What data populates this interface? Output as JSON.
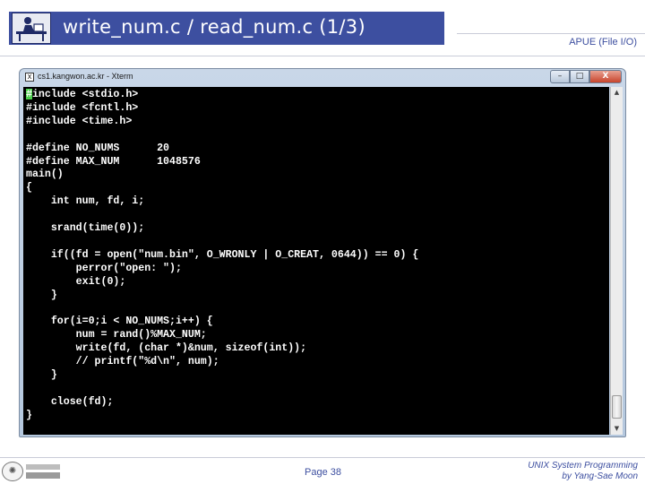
{
  "slide": {
    "title": "write_num.c / read_num.c (1/3)",
    "header_right": "APUE (File I/O)",
    "page": "Page 38",
    "course_line1": "UNIX System Programming",
    "course_line2": "by Yang-Sae Moon",
    "accent_color": "#3d4fa0"
  },
  "window": {
    "title": "cs1.kangwon.ac.kr - Xterm",
    "minimize_label": "–",
    "maximize_label": "□",
    "close_label": "X"
  },
  "code": [
    "#include <stdio.h>",
    "#include <fcntl.h>",
    "#include <time.h>",
    "",
    "#define NO_NUMS      20",
    "#define MAX_NUM      1048576",
    "main()",
    "{",
    "    int num, fd, i;",
    "",
    "    srand(time(0));",
    "",
    "    if((fd = open(\"num.bin\", O_WRONLY | O_CREAT, 0644)) == 0) {",
    "        perror(\"open: \");",
    "        exit(0);",
    "    }",
    "",
    "    for(i=0;i < NO_NUMS;i++) {",
    "        num = rand()%MAX_NUM;",
    "        write(fd, (char *)&num, sizeof(int));",
    "        // printf(\"%d\\n\", num);",
    "    }",
    "",
    "    close(fd);",
    "}"
  ],
  "icons": {
    "header_logo": "person-at-desk-icon",
    "scroll_up": "arrow-up-icon",
    "scroll_down": "arrow-down-icon",
    "university_emblem": "emblem-icon"
  }
}
